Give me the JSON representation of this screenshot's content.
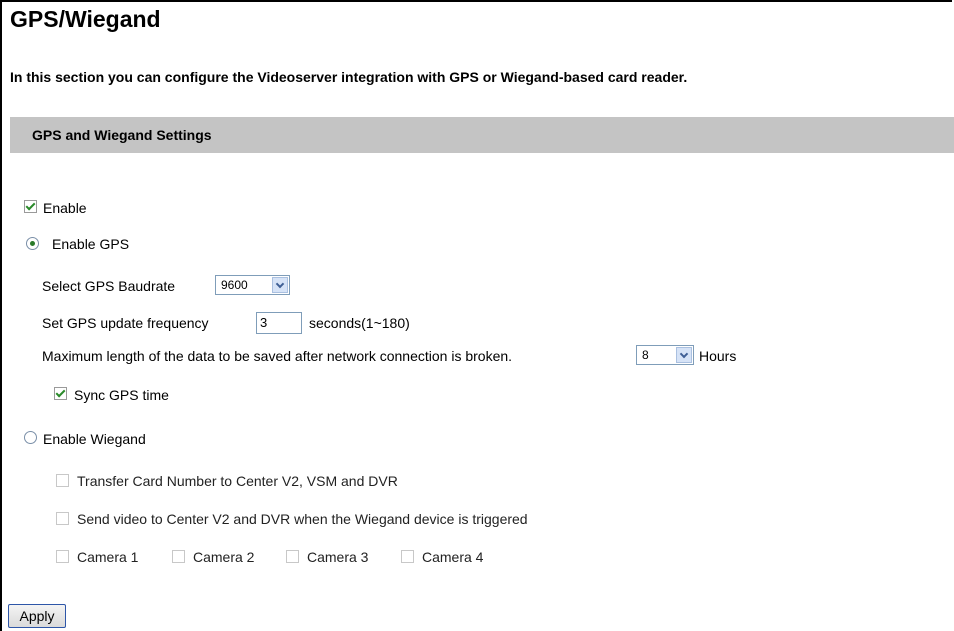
{
  "page": {
    "title": "GPS/Wiegand",
    "intro": "In this section you can configure the Videoserver integration with GPS or Wiegand-based card reader."
  },
  "section": {
    "header": "GPS and Wiegand Settings"
  },
  "enable": {
    "label": "Enable",
    "checked": true
  },
  "gps": {
    "radio_label": "Enable GPS",
    "selected": true,
    "baudrate_label": "Select GPS Baudrate",
    "baudrate_value": "9600",
    "freq_label": "Set GPS update frequency",
    "freq_value": "3",
    "freq_suffix": "seconds(1~180)",
    "maxlen_label": "Maximum length of the data to be saved after network connection is broken.",
    "maxlen_value": "8",
    "maxlen_suffix": "Hours",
    "sync_label": "Sync GPS time",
    "sync_checked": true
  },
  "wiegand": {
    "radio_label": "Enable Wiegand",
    "selected": false,
    "transfer_label": "Transfer Card Number to Center V2, VSM and DVR",
    "send_video_label": "Send video to Center V2 and DVR when the Wiegand device is triggered",
    "cameras": [
      "Camera 1",
      "Camera 2",
      "Camera 3",
      "Camera 4"
    ]
  },
  "actions": {
    "apply_label": "Apply"
  }
}
